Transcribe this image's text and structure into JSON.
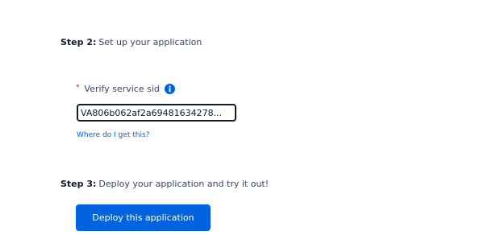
{
  "step2": {
    "number": "Step 2:",
    "text": "Set up your application"
  },
  "field": {
    "required_mark": "*",
    "label": "Verify service sid",
    "info_icon": "info-circle-icon",
    "value": "VA806b062af2a69481634278..."
  },
  "help_link": "Where do I get this?",
  "step3": {
    "number": "Step 3:",
    "text": "Deploy your application and try it out!"
  },
  "deploy_button": "Deploy this application",
  "colors": {
    "brand_blue": "#0263e0",
    "required_red": "#d61f1f",
    "text_dark": "#121c2d"
  }
}
